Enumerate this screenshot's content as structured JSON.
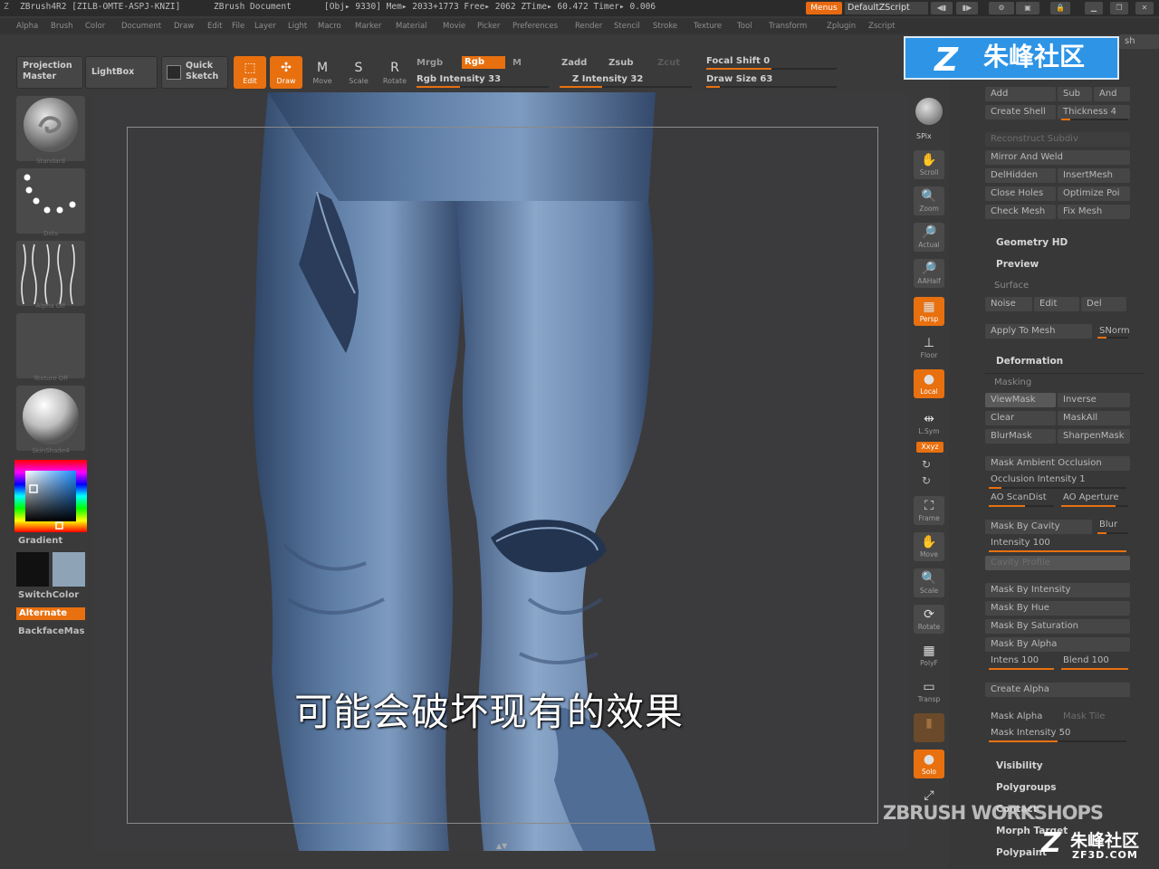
{
  "titlebar": {
    "app": "ZBrush4R2 [ZILB-OMTE-ASPJ-KNZI]",
    "doc": "ZBrush Document",
    "stats": "[Obj▸ 9330] Mem▸ 2033+1773  Free▸ 2062  ZTime▸ 60.472  Timer▸ 0.006",
    "menus_btn": "Menus",
    "script": "DefaultZScript"
  },
  "menubar": [
    "Alpha",
    "Brush",
    "Color",
    "Document",
    "Draw",
    "Edit",
    "File",
    "Layer",
    "Light",
    "Macro",
    "Marker",
    "Material",
    "Movie",
    "Picker",
    "Preferences",
    "Render",
    "Stencil",
    "Stroke",
    "Texture",
    "Tool",
    "Transform",
    "Zplugin",
    "Zscript"
  ],
  "shelf": {
    "projection_master": "Projection Master",
    "lightbox": "LightBox",
    "quick_sketch": "Quick Sketch",
    "edit": "Edit",
    "draw": "Draw",
    "move": "Move",
    "scale": "Scale",
    "rotate": "Rotate",
    "mrgb": "Mrgb",
    "rgb": "Rgb",
    "m": "M",
    "rgb_intensity": "Rgb Intensity 33",
    "rgb_intensity_value": 33,
    "zadd": "Zadd",
    "zsub": "Zsub",
    "zcut": "Zcut",
    "z_intensity": "Z Intensity 32",
    "z_intensity_value": 32,
    "focal_shift": "Focal Shift 0",
    "focal_shift_value": 0,
    "draw_size": "Draw Size 63",
    "draw_size_value": 63
  },
  "lefttray": {
    "brush_cap": "Standard",
    "stroke_cap": "Dots",
    "alpha_cap": "Alpha Off",
    "texture_cap": "Texture Off",
    "material_cap": "SkinShade4",
    "gradient": "Gradient",
    "switchcolor": "SwitchColor",
    "alternate": "Alternate",
    "backface": "BackfaceMas",
    "main_color": "#8ea4b6",
    "secondary_color": "#111111"
  },
  "viewport": {
    "subtitle": "可能会破坏现有的效果",
    "mesh_color": "#5b7aa2"
  },
  "righttools": {
    "bpr": "BPR",
    "spix": "SPix",
    "scroll": "Scroll",
    "zoom": "Zoom",
    "actual": "Actual",
    "aahalf": "AAHalf",
    "persp": "Persp",
    "floor": "Floor",
    "local": "Local",
    "lsym": "L.Sym",
    "xyz": "Xxyz",
    "frame": "Frame",
    "move": "Move",
    "scale": "Scale",
    "rotate": "Rotate",
    "polyf": "PolyF",
    "transp": "Transp",
    "solo": "Solo"
  },
  "rightpanel": {
    "sh_tab": "sh",
    "add": "Add",
    "sub": "Sub",
    "and": "And",
    "create_shell": "Create Shell",
    "thickness": "Thickness 4",
    "remesh_mode": "Reconstruct Subdiv",
    "mirror_weld": "Mirror And Weld",
    "delhidden": "DelHidden",
    "insertmesh": "InsertMesh",
    "close_holes": "Close Holes",
    "optimize": "Optimize Poi",
    "check_mesh": "Check Mesh",
    "fix_mesh": "Fix Mesh",
    "geometry_hd": "Geometry HD",
    "preview": "Preview",
    "surface": "Surface",
    "noise": "Noise",
    "edit": "Edit",
    "del": "Del",
    "apply_to_mesh": "Apply To Mesh",
    "snorm": "SNorm",
    "deformation": "Deformation",
    "masking": "Masking",
    "viewmask": "ViewMask",
    "inverse": "Inverse",
    "clear": "Clear",
    "maskall": "MaskAll",
    "blurmask": "BlurMask",
    "sharpenmask": "SharpenMask",
    "mask_ao": "Mask Ambient Occlusion",
    "occ_intensity": "Occlusion Intensity 1",
    "ao_scandist": "AO ScanDist",
    "ao_aperture": "AO Aperture",
    "mask_by_cavity": "Mask By Cavity",
    "blur": "Blur",
    "intensity_100": "Intensity 100",
    "cavity_profile": "Cavity Profile",
    "mask_by_intensity": "Mask By Intensity",
    "mask_by_hue": "Mask By Hue",
    "mask_by_saturation": "Mask By Saturation",
    "mask_by_alpha": "Mask By Alpha",
    "intens_100": "Intens 100",
    "blend_100": "Blend 100",
    "create_alpha": "Create Alpha",
    "mask_alpha": "Mask Alpha",
    "mask_tile": "Mask Tile",
    "mask_intensity": "Mask Intensity 50",
    "visibility": "Visibility",
    "polygroups": "Polygroups",
    "contact": "Contact",
    "morph_target": "Morph Target",
    "polypaint": "Polypaint"
  },
  "watermarks": {
    "badge": "朱峰社区",
    "zbw": "ZBRUSH WORKSHOPS",
    "zf_cn": "朱峰社区",
    "zf_url": "ZF3D.COM"
  }
}
